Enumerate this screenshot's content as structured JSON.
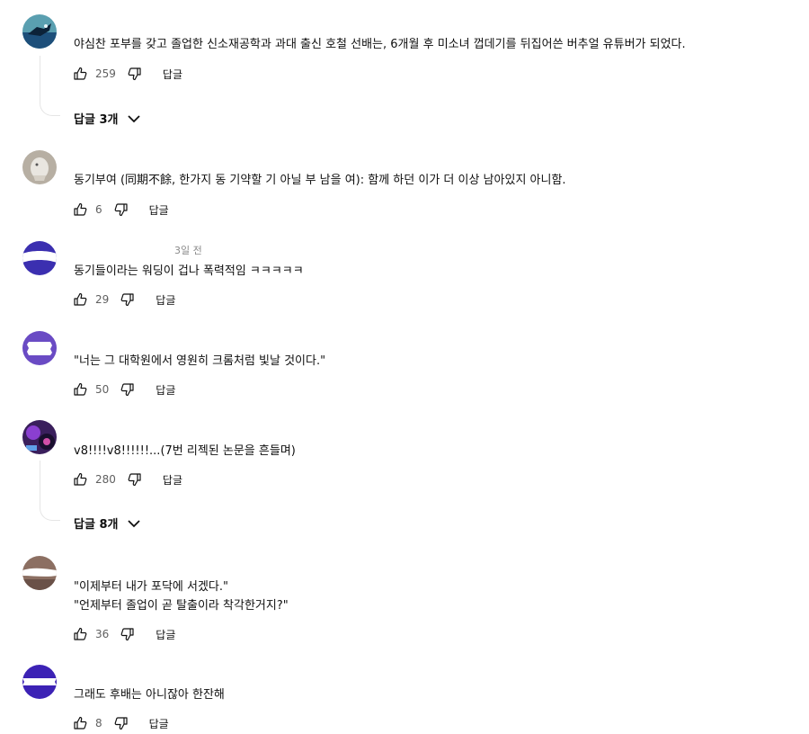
{
  "comments": [
    {
      "author": "",
      "time": "",
      "text": "야심찬 포부를 갖고 졸업한 신소재공학과 과대 출신 호철 선배는, 6개월 후 미소녀 껍데기를 뒤집어쓴 버추얼 유튜버가 되었다.",
      "likes": "259",
      "reply_label": "답글",
      "replies_toggle": "답글 3개",
      "avatar_color": "#3a8fa3"
    },
    {
      "author": "",
      "time": "",
      "text": "동기부여 (同期不餘, 한가지 동 기약할 기 아닐 부 남을 여): 함께 하던 이가 더 이상 남아있지 아니함.",
      "likes": "6",
      "reply_label": "답글",
      "avatar_color": "#b9b3a6"
    },
    {
      "author": "",
      "time": "3일 전",
      "text": "동기들이라는 워딩이 겁나 폭력적임 ㅋㅋㅋㅋㅋ",
      "likes": "29",
      "reply_label": "답글",
      "avatar_color": "#3b2fb0"
    },
    {
      "author": "",
      "time": "",
      "text": "\"너는 그 대학원에서 영원히 크롬처럼 빛날 것이다.\"",
      "likes": "50",
      "reply_label": "답글",
      "avatar_color": "#6a4bc4"
    },
    {
      "author": "",
      "time": "",
      "text": "v8!!!!v8!!!!!!...(7번 리젝된 논문을 흔들며)",
      "likes": "280",
      "reply_label": "답글",
      "replies_toggle": "답글 8개",
      "avatar_color": "#4a2a6e"
    },
    {
      "author": "",
      "time": "",
      "text_line1": "\"이제부터 내가 포닥에 서겠다.\"",
      "text_line2": "\"언제부터 졸업이 곧 탈출이라 착각한거지?\"",
      "likes": "36",
      "reply_label": "답글",
      "avatar_color": "#8c6f62"
    },
    {
      "author": "",
      "time": "",
      "text": "그래도 후배는 아니잖아 한잔해",
      "likes": "8",
      "reply_label": "답글",
      "avatar_color": "#3c22b5"
    }
  ]
}
